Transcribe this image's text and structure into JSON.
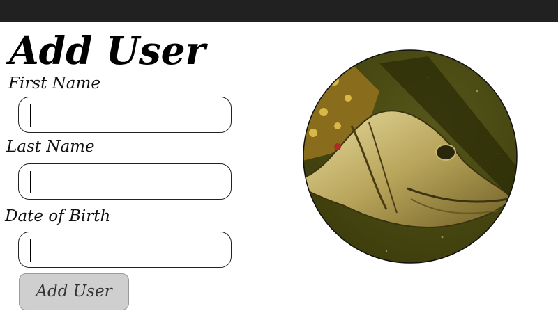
{
  "form": {
    "title": "Add User",
    "fields": [
      {
        "label": "First Name",
        "value": "",
        "placeholder": ""
      },
      {
        "label": "Last Name",
        "value": "",
        "placeholder": ""
      },
      {
        "label": "Date of Birth",
        "value": "",
        "placeholder": ""
      }
    ],
    "submit_label": "Add User"
  },
  "image": {
    "subject": "fish-head-painting"
  },
  "colors": {
    "topbar": "#212121",
    "button_bg": "#cfcfcf",
    "image_background": "#4a4a10"
  }
}
